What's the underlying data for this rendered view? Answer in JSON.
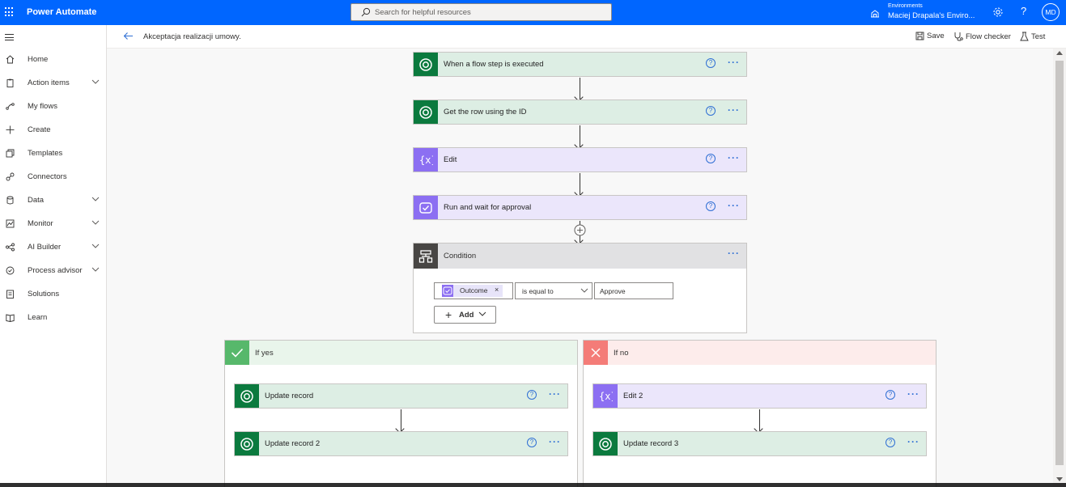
{
  "app": {
    "title": "Power Automate"
  },
  "search": {
    "placeholder": "Search for helpful resources"
  },
  "environment": {
    "label": "Environments",
    "name": "Maciej Drapala's Enviro..."
  },
  "user": {
    "initials": "MD"
  },
  "colors": {
    "brand": "#0066ff",
    "dataverse": "#0b7a3e",
    "variable": "#8c6ff2",
    "condition": "#484644",
    "yes": "#57b86b",
    "no": "#f47c78"
  },
  "nav": {
    "items": [
      {
        "label": "Home",
        "icon": "home-icon",
        "expandable": false
      },
      {
        "label": "Action items",
        "icon": "clipboard-icon",
        "expandable": true
      },
      {
        "label": "My flows",
        "icon": "flow-icon",
        "expandable": false
      },
      {
        "label": "Create",
        "icon": "plus-icon",
        "expandable": false
      },
      {
        "label": "Templates",
        "icon": "templates-icon",
        "expandable": false
      },
      {
        "label": "Connectors",
        "icon": "connector-icon",
        "expandable": false
      },
      {
        "label": "Data",
        "icon": "database-icon",
        "expandable": true
      },
      {
        "label": "Monitor",
        "icon": "monitor-icon",
        "expandable": true
      },
      {
        "label": "AI Builder",
        "icon": "ai-builder-icon",
        "expandable": true
      },
      {
        "label": "Process advisor",
        "icon": "process-advisor-icon",
        "expandable": true
      },
      {
        "label": "Solutions",
        "icon": "solutions-icon",
        "expandable": false
      },
      {
        "label": "Learn",
        "icon": "book-icon",
        "expandable": false
      }
    ]
  },
  "flow": {
    "name": "Akceptacja realizacji umowy.",
    "save_label": "Save",
    "checker_label": "Flow checker",
    "test_label": "Test"
  },
  "steps": [
    {
      "title": "When a flow step is executed",
      "kind": "dataverse"
    },
    {
      "title": "Get the row using the ID",
      "kind": "dataverse"
    },
    {
      "title": "Edit",
      "kind": "variable"
    },
    {
      "title": "Run and wait for approval",
      "kind": "approval"
    }
  ],
  "condition": {
    "title": "Condition",
    "left_token": "Outcome",
    "operator": "is equal to",
    "value": "Approve",
    "add_label": "Add"
  },
  "branches": {
    "yes": {
      "label": "If yes",
      "steps": [
        "Update record",
        "Update record 2"
      ]
    },
    "no": {
      "label": "If no",
      "steps": [
        "Edit 2",
        "Update record 3"
      ]
    }
  },
  "help_glyph": "?",
  "more_glyph": "···"
}
